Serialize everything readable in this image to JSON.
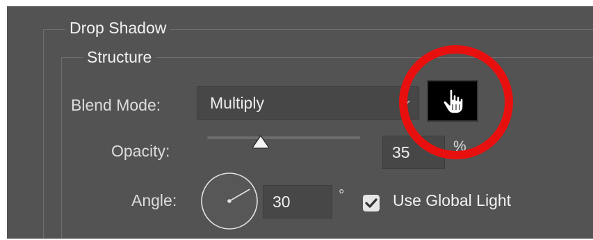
{
  "panel": {
    "group_title": "Drop Shadow",
    "section_title": "Structure"
  },
  "blend_mode": {
    "label": "Blend Mode:",
    "value": "Multiply",
    "dropdown_icon": "chevron-down-icon",
    "swatch_color": "#000000",
    "cursor_icon": "hand-pointer-icon"
  },
  "opacity": {
    "label": "Opacity:",
    "value": "35",
    "unit": "%",
    "slider_level_percent": 35
  },
  "angle": {
    "label": "Angle:",
    "value": "30",
    "unit": "°",
    "dial_degrees": 30
  },
  "global_light": {
    "label": "Use Global Light",
    "checked": true
  },
  "annotation": {
    "circle_color": "#e8100e"
  }
}
